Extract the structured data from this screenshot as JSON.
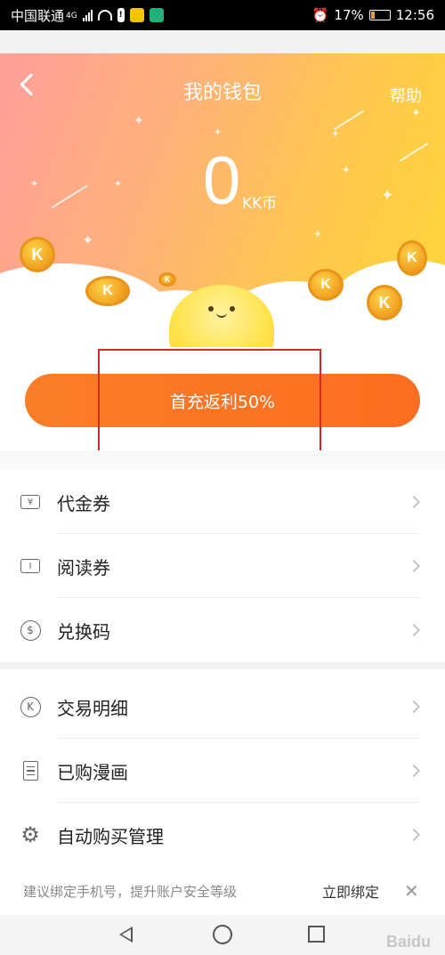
{
  "status_bar": {
    "carrier": "中国联通",
    "network": "4G",
    "battery": "17%",
    "time": "12:56"
  },
  "header": {
    "title": "我的钱包",
    "help": "帮助"
  },
  "balance": {
    "amount": "0",
    "unit": "KK币"
  },
  "coin_letter": "K",
  "promo_button": {
    "label": "首充返利50%"
  },
  "menu_group_1": [
    {
      "label": "代金券",
      "icon": "voucher-icon",
      "icon_text": "¥"
    },
    {
      "label": "阅读券",
      "icon": "ticket-icon",
      "icon_text": "I"
    },
    {
      "label": "兑换码",
      "icon": "dollar-circle-icon",
      "icon_text": "$"
    }
  ],
  "menu_group_2": [
    {
      "label": "交易明细",
      "icon": "k-circle-icon",
      "icon_text": "K"
    },
    {
      "label": "已购漫画",
      "icon": "document-icon"
    },
    {
      "label": "自动购买管理",
      "icon": "gear-icon"
    }
  ],
  "bind_bar": {
    "tip": "建议绑定手机号，提升账户安全等级",
    "action": "立即绑定",
    "close": "✕"
  },
  "watermark": "Baidu",
  "colors": {
    "accent": "#fb7d28",
    "highlight_box": "#d42a2a"
  }
}
